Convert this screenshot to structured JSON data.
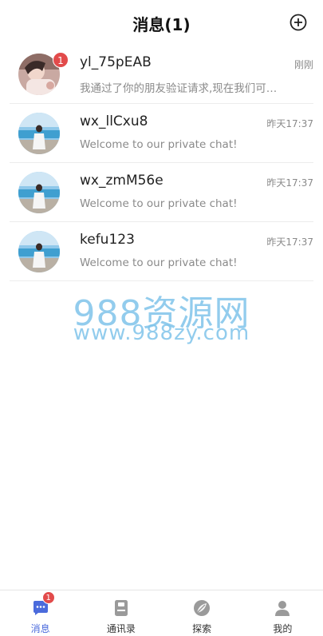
{
  "header": {
    "title": "消息(1)",
    "add_icon": "plus-circle-icon"
  },
  "conversations": [
    {
      "name": "yl_75pEAB",
      "message": "我通过了你的朋友验证请求,现在我们可以开始聊天了",
      "time": "刚刚",
      "unread": "1",
      "avatar": "girl-photo"
    },
    {
      "name": "wx_llCxu8",
      "message": "Welcome to our private chat!",
      "time": "昨天17:37",
      "unread": "",
      "avatar": "beach-photo"
    },
    {
      "name": "wx_zmM56e",
      "message": "Welcome to our private chat!",
      "time": "昨天17:37",
      "unread": "",
      "avatar": "beach-photo"
    },
    {
      "name": "kefu123",
      "message": "Welcome to our private chat!",
      "time": "昨天17:37",
      "unread": "",
      "avatar": "beach-photo"
    }
  ],
  "watermark": {
    "line1": "988资源网",
    "line2": "www.988zy.com"
  },
  "tabbar": {
    "items": [
      {
        "label": "消息",
        "icon": "chat-bubble-icon",
        "badge": "1",
        "active": true
      },
      {
        "label": "通讯录",
        "icon": "contacts-book-icon",
        "badge": "",
        "active": false
      },
      {
        "label": "探索",
        "icon": "explore-leaf-icon",
        "badge": "",
        "active": false
      },
      {
        "label": "我的",
        "icon": "user-icon",
        "badge": "",
        "active": false
      }
    ]
  },
  "colors": {
    "accent": "#4b6bdc",
    "badge": "#e24b4b",
    "watermark": "#7fc4ea"
  }
}
